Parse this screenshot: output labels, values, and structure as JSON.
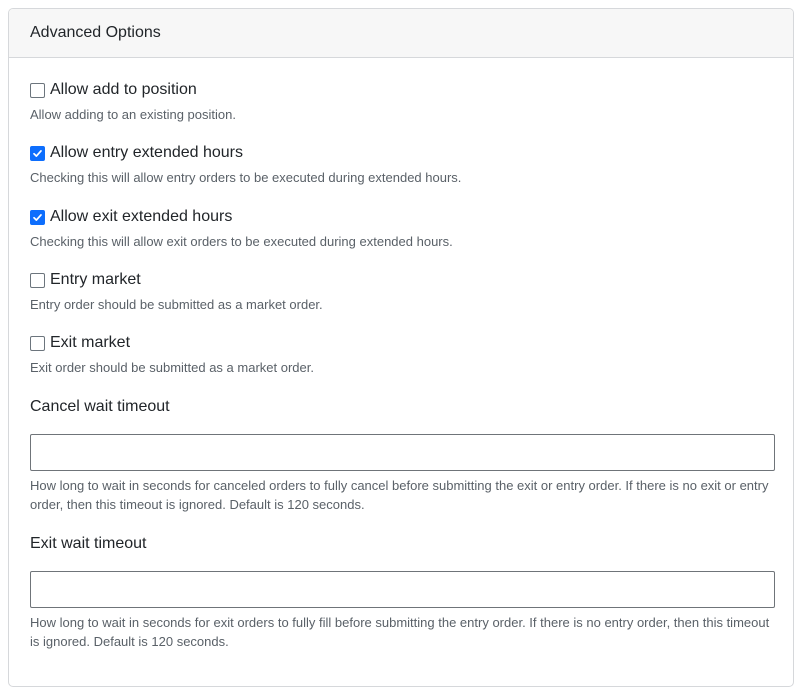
{
  "header": {
    "title": "Advanced Options"
  },
  "options": [
    {
      "label": "Allow add to position",
      "checked": false,
      "help": "Allow adding to an existing position."
    },
    {
      "label": "Allow entry extended hours",
      "checked": true,
      "help": "Checking this will allow entry orders to be executed during extended hours."
    },
    {
      "label": "Allow exit extended hours",
      "checked": true,
      "help": "Checking this will allow exit orders to be executed during extended hours."
    },
    {
      "label": "Entry market",
      "checked": false,
      "help": "Entry order should be submitted as a market order."
    },
    {
      "label": "Exit market",
      "checked": false,
      "help": "Exit order should be submitted as a market order."
    }
  ],
  "fields": [
    {
      "label": "Cancel wait timeout",
      "value": "",
      "help": "How long to wait in seconds for canceled orders to fully cancel before submitting the exit or entry order. If there is no exit or entry order, then this timeout is ignored. Default is 120 seconds."
    },
    {
      "label": "Exit wait timeout",
      "value": "",
      "help": "How long to wait in seconds for exit orders to fully fill before submitting the entry order. If there is no entry order, then this timeout is ignored. Default is 120 seconds."
    }
  ],
  "colors": {
    "accent": "#0d6efd",
    "header_bg": "#f7f7f7",
    "help_text": "#5a6168"
  }
}
